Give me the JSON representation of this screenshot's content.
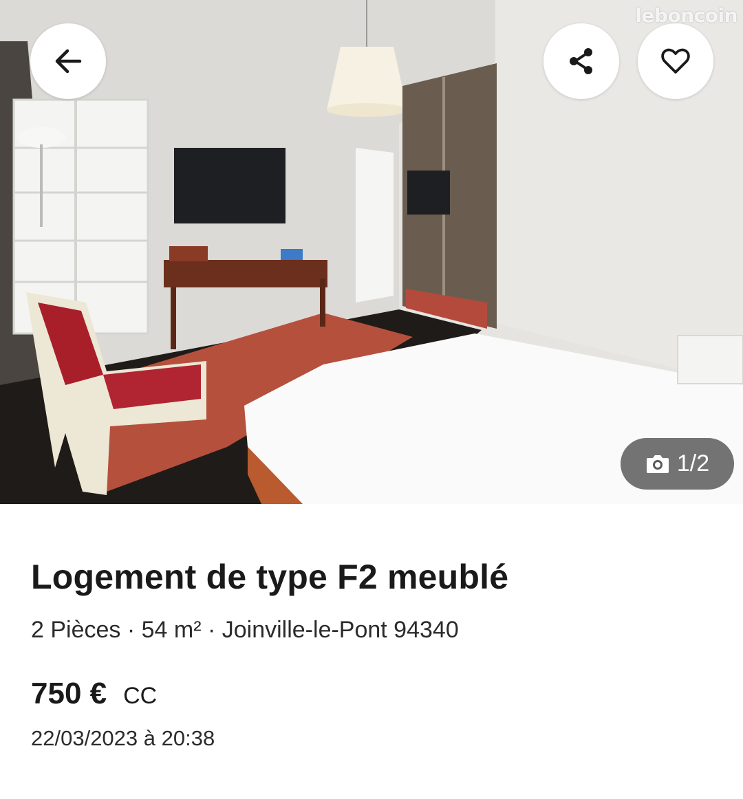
{
  "gallery": {
    "watermark": "leboncoin",
    "counter": "1/2",
    "icons": {
      "back": "arrow-left-icon",
      "share": "share-icon",
      "favorite": "heart-icon",
      "camera": "camera-icon"
    }
  },
  "listing": {
    "title": "Logement de type F2 meublé",
    "details": "2 Pièces · 54 m² · Joinville-le-Pont 94340",
    "price": "750 €",
    "charges": "CC",
    "date": "22/03/2023 à 20:38"
  }
}
